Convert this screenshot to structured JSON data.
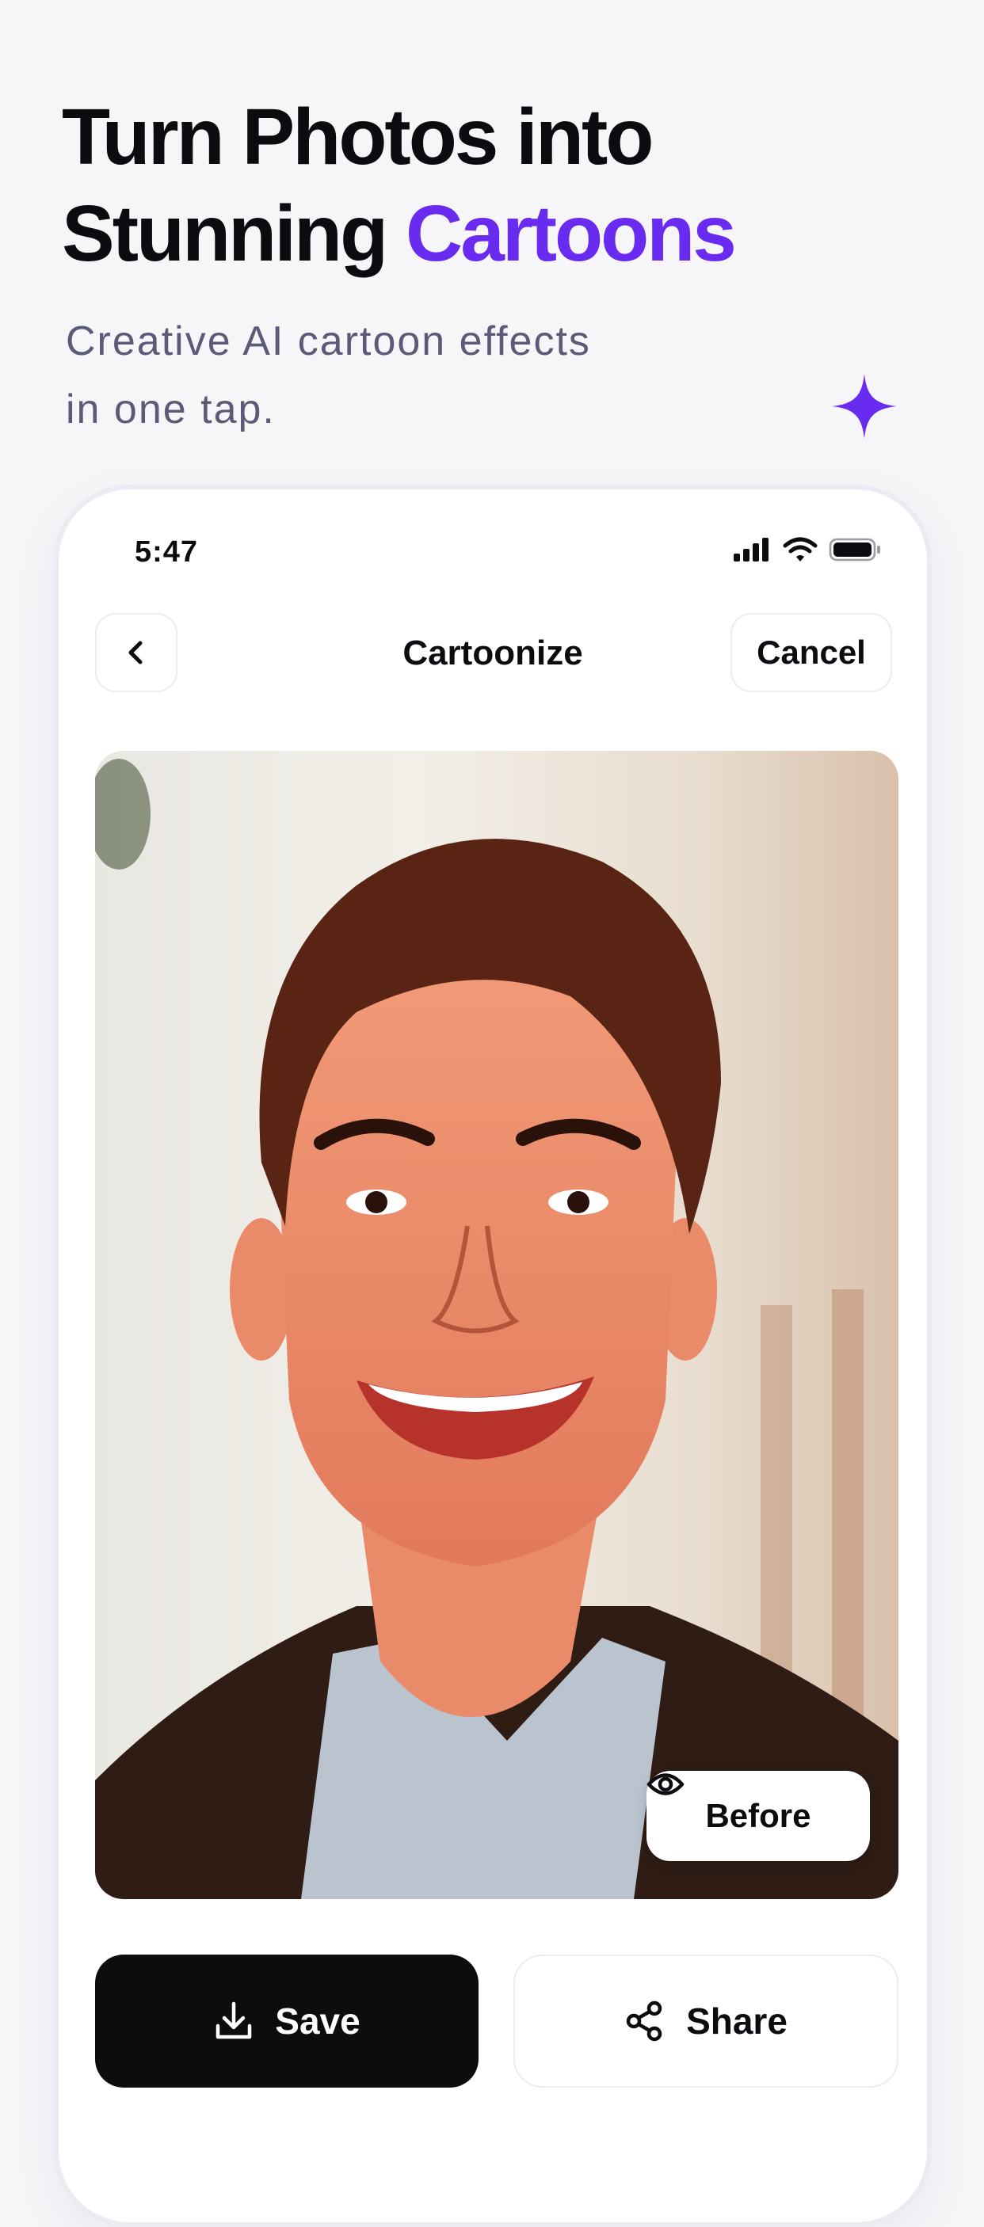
{
  "hero": {
    "title_line1": "Turn Photos into",
    "title_line2_plain": "Stunning ",
    "title_line2_accent": "Cartoons",
    "subtitle_line1": "Creative AI cartoon effects",
    "subtitle_line2": "in one tap.",
    "accent_color": "#6a2bf0"
  },
  "status_bar": {
    "time": "5:47",
    "icons": [
      "cellular-signal-icon",
      "wifi-icon",
      "battery-icon"
    ]
  },
  "navbar": {
    "title": "Cartoonize",
    "cancel_label": "Cancel",
    "back_icon": "chevron-left-icon"
  },
  "preview": {
    "before_label": "Before",
    "before_icon": "eye-icon"
  },
  "actions": {
    "save_label": "Save",
    "save_icon": "download-icon",
    "share_label": "Share",
    "share_icon": "share-icon"
  }
}
